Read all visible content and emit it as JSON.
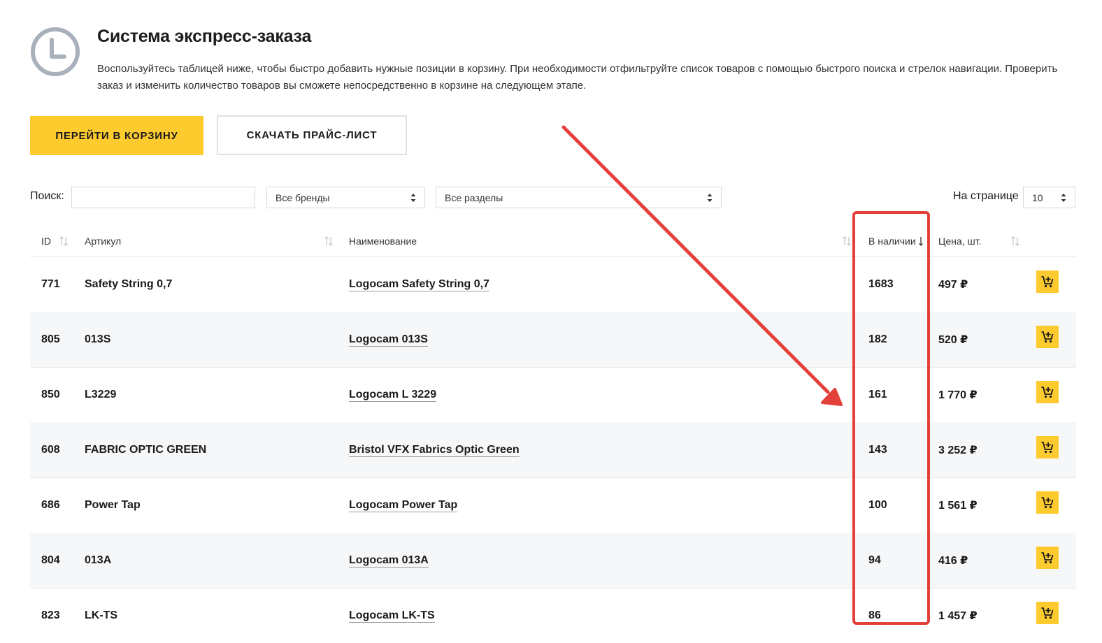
{
  "header": {
    "title": "Система экспресс-заказа",
    "description": "Воспользуйтесь таблицей ниже, чтобы быстро добавить нужные позиции в корзину. При необходимости отфильтруйте список товаров с помощью быстрого поиска и стрелок навигации. Проверить заказ и изменить количество товаров вы сможете непосредственно в корзине на следующем этапе."
  },
  "actions": {
    "cart_label": "Перейти в корзину",
    "price_label": "Скачать прайс-лист"
  },
  "filters": {
    "search_label": "Поиск:",
    "search_value": "",
    "brands_selected": "Все бренды",
    "sections_selected": "Все разделы",
    "per_page_label": "На странице",
    "per_page_selected": "10"
  },
  "table": {
    "columns": {
      "id": "ID",
      "article": "Артикул",
      "name": "Наименование",
      "stock": "В наличии",
      "price": "Цена, шт."
    },
    "rows": [
      {
        "id": "771",
        "article": "Safety String 0,7",
        "name": "Logocam Safety String 0,7",
        "stock": "1683",
        "price": "497 ₽"
      },
      {
        "id": "805",
        "article": "013S",
        "name": "Logocam 013S",
        "stock": "182",
        "price": "520 ₽"
      },
      {
        "id": "850",
        "article": "L3229",
        "name": "Logocam L 3229",
        "stock": "161",
        "price": "1 770 ₽"
      },
      {
        "id": "608",
        "article": "FABRIC OPTIC GREEN",
        "name": "Bristol VFX Fabrics Optic Green",
        "stock": "143",
        "price": "3 252 ₽"
      },
      {
        "id": "686",
        "article": "Power Tap",
        "name": "Logocam Power Tap",
        "stock": "100",
        "price": "1 561 ₽"
      },
      {
        "id": "804",
        "article": "013A",
        "name": "Logocam 013A",
        "stock": "94",
        "price": "416 ₽"
      },
      {
        "id": "823",
        "article": "LK-TS",
        "name": "Logocam LK-TS",
        "stock": "86",
        "price": "1 457 ₽"
      }
    ]
  },
  "colors": {
    "accent": "#fecb2f",
    "annotation": "#e4403a",
    "row_alt": "#f6f7f8"
  }
}
